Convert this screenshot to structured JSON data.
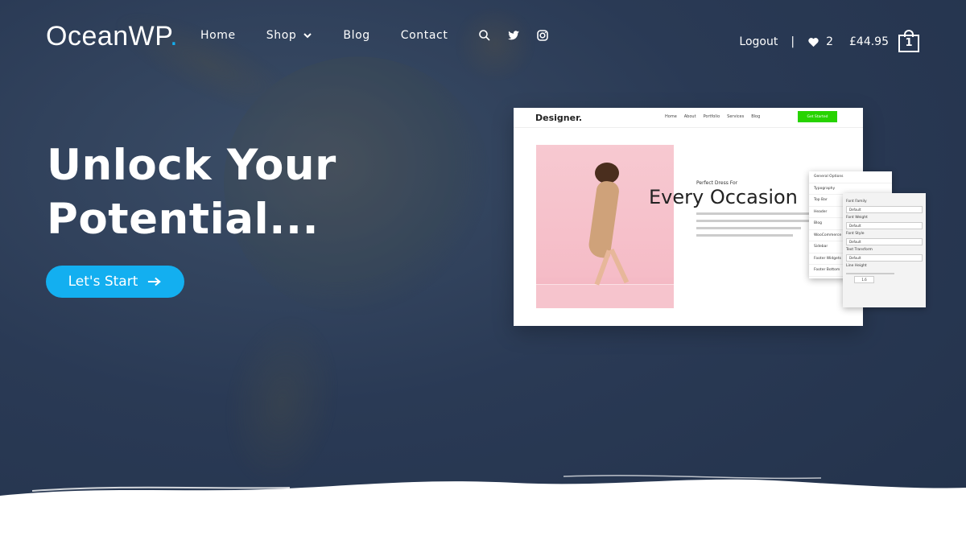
{
  "header": {
    "logo_text": "OceanWP",
    "logo_dot": ".",
    "nav": [
      {
        "label": "Home"
      },
      {
        "label": "Shop"
      },
      {
        "label": "Blog"
      },
      {
        "label": "Contact"
      }
    ],
    "icons": [
      "search-icon",
      "twitter-icon",
      "instagram-icon"
    ],
    "logout_label": "Logout",
    "separator": "|",
    "wishlist_count": "2",
    "cart_total": "£44.95",
    "cart_count": "1"
  },
  "hero": {
    "title_line1": "Unlock Your",
    "title_line2": "Potential...",
    "cta_label": "Let's Start"
  },
  "mockup": {
    "logo": "Designer.",
    "nav": [
      "Home",
      "About",
      "Portfolio",
      "Services",
      "Blog"
    ],
    "button": "Get Started",
    "subheading": "Perfect Dress For",
    "heading": "Every Occasion",
    "panel1_items": [
      "General Options",
      "Typography",
      "Top Bar",
      "Header",
      "Blog",
      "WooCommerce",
      "Sidebar",
      "Footer Widgets",
      "Footer Bottom"
    ],
    "panel2": {
      "font_family_label": "Font Family",
      "font_family_value": "Default",
      "font_weight_label": "Font Weight",
      "font_weight_value": "Default",
      "font_style_label": "Font Style",
      "font_style_value": "Default",
      "text_transform_label": "Text Transform",
      "text_transform_value": "Default",
      "line_height_label": "Line Height",
      "line_height_value": "1.6"
    }
  },
  "colors": {
    "accent": "#13aff0",
    "hero_bg": "#2a3a55",
    "mock_button": "#27d300"
  }
}
